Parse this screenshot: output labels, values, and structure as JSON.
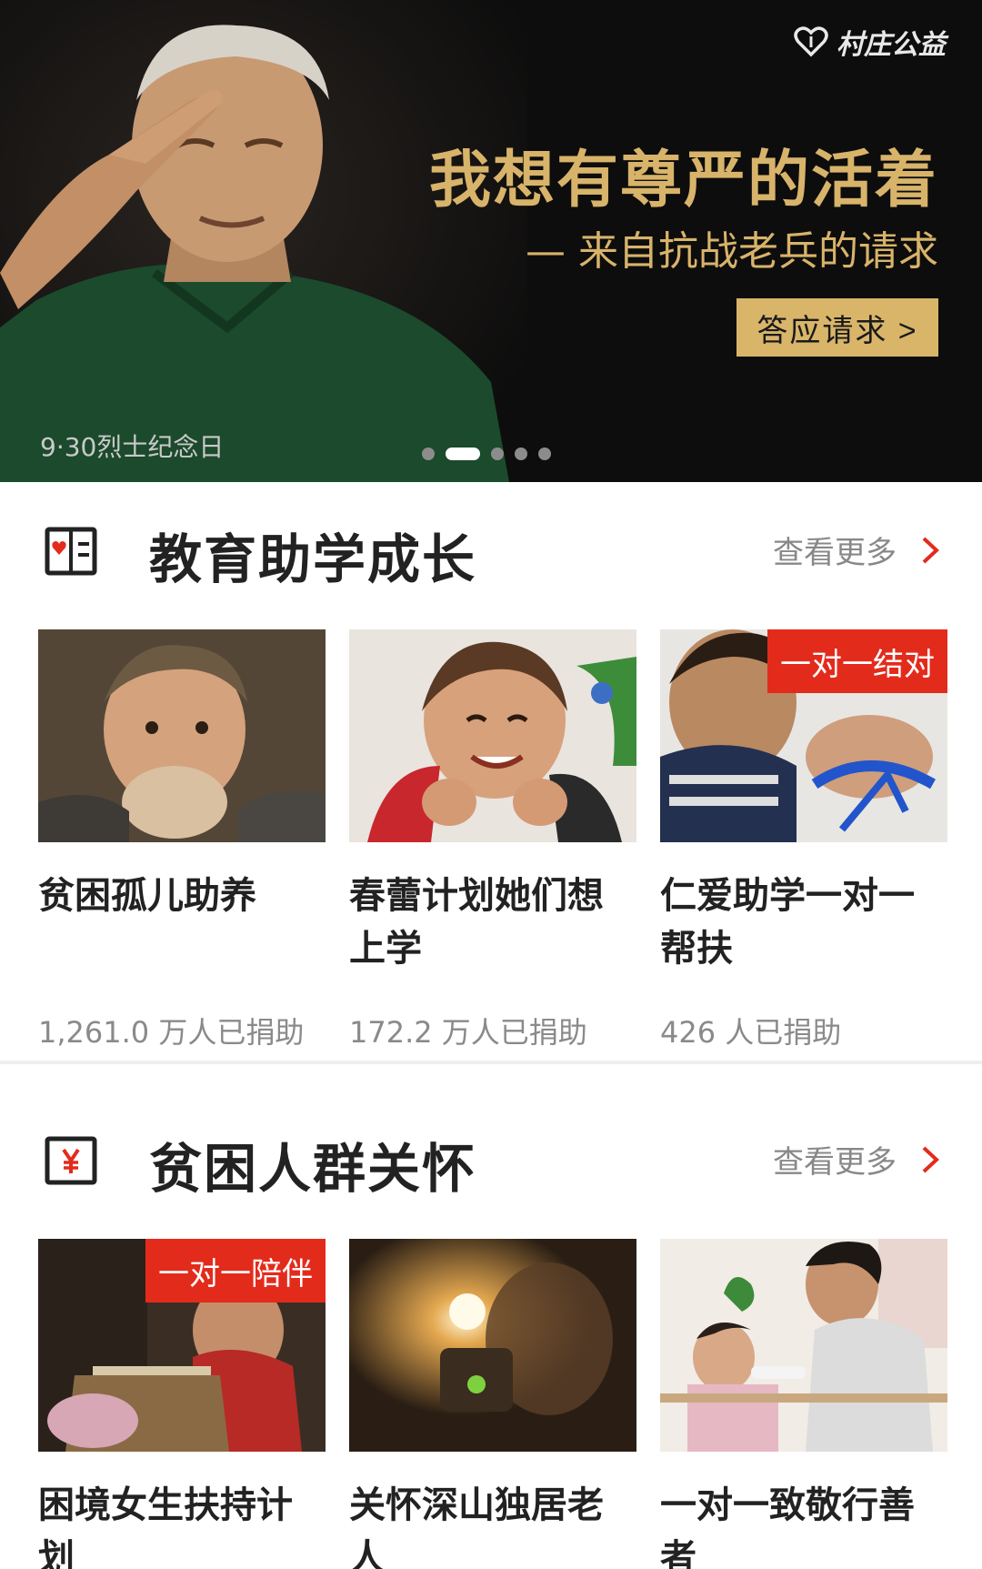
{
  "banner": {
    "brand": "村庄公益",
    "headline": "我想有尊严的活着",
    "subline": "— 来自抗战老兵的请求",
    "cta": "答应请求 >",
    "caption": "9·30烈士纪念日",
    "slides": 5,
    "active_slide": 2,
    "accent_color": "#d8b36a"
  },
  "sections": [
    {
      "icon": "book-heart-icon",
      "title": "教育助学成长",
      "more": "查看更多",
      "cards": [
        {
          "title": "贫困孤儿助养",
          "stat": "1,261.0 万人已捐助",
          "tag": ""
        },
        {
          "title": "春蕾计划她们想上学",
          "stat": "172.2 万人已捐助",
          "tag": ""
        },
        {
          "title": "仁爱助学一对一帮扶",
          "stat": "426 人已捐助",
          "tag": "一对一结对"
        }
      ]
    },
    {
      "icon": "yuan-box-icon",
      "title": "贫困人群关怀",
      "more": "查看更多",
      "cards": [
        {
          "title": "困境女生扶持计划",
          "tag": "一对一陪伴"
        },
        {
          "title": "关怀深山独居老人",
          "tag": ""
        },
        {
          "title": "一对一致敬行善者",
          "tag": ""
        }
      ]
    }
  ],
  "colors": {
    "tag_red": "#e32b1c",
    "chevron_red": "#e32b1c"
  }
}
